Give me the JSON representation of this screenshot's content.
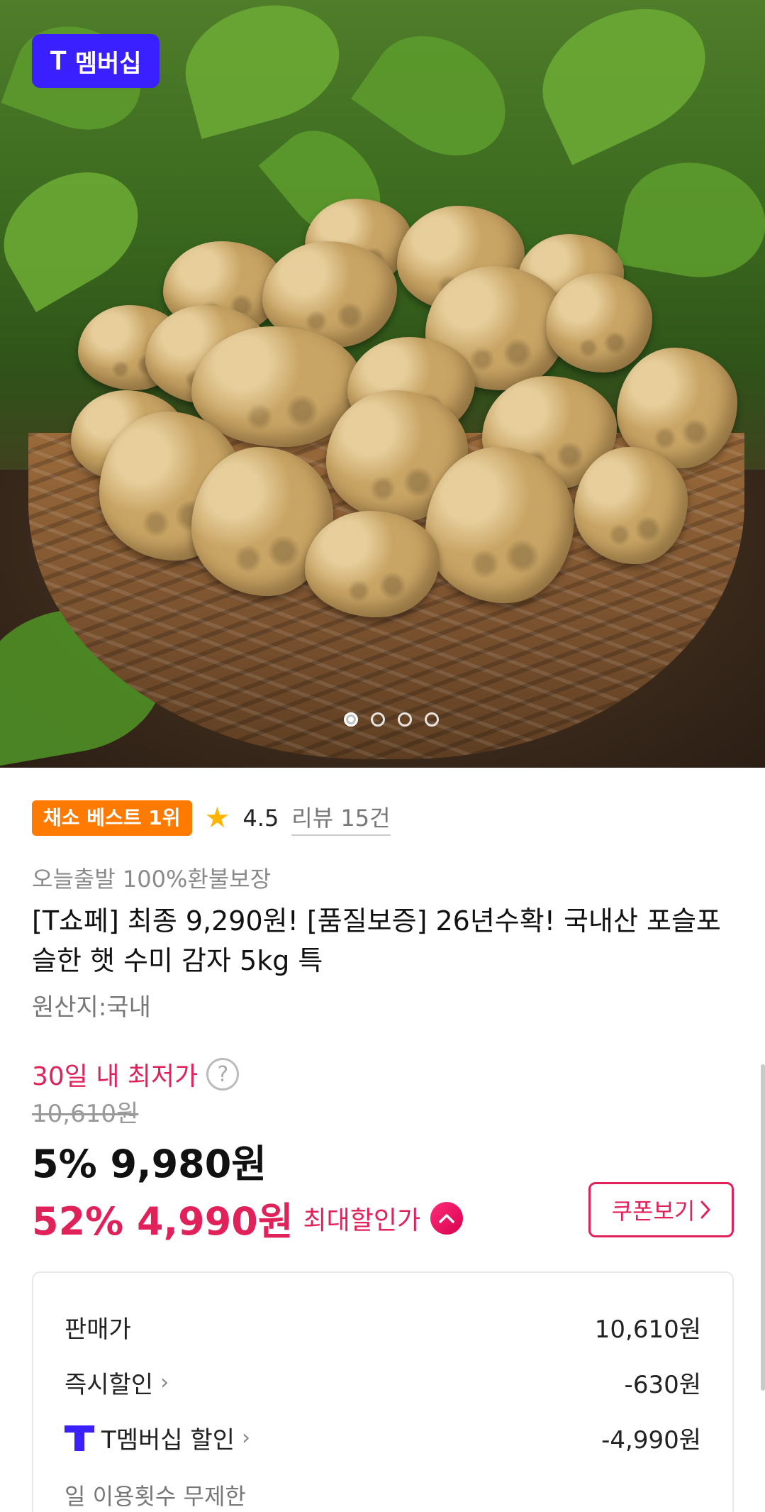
{
  "hero": {
    "brand_badge": "멤버십",
    "brand_mark": "T",
    "carousel": {
      "count": 4,
      "active_index": 0
    }
  },
  "product": {
    "best_badge": "채소 베스트 1위",
    "rating": "4.5",
    "reviews": "리뷰 15건",
    "tags": "오늘출발 100%환불보장",
    "title": "[T쇼페] 최종 9,290원! [품질보증] 26년수확! 국내산 포슬포슬한 햇 수미 감자 5kg 특",
    "origin": "원산지:국내"
  },
  "pricing": {
    "lowest_label": "30일 내 최저가",
    "original_price": "10,610원",
    "sale_line": "5% 9,980원",
    "max_discount_line": "52% 4,990원",
    "max_discount_label": "최대할인가",
    "coupon_button": "쿠폰보기"
  },
  "breakdown": {
    "rows": [
      {
        "label": "판매가",
        "value": "10,610원"
      },
      {
        "label": "즉시할인",
        "value": "-630원"
      },
      {
        "label": "T멤버십 할인",
        "value": "-4,990원"
      }
    ],
    "usage_note": "일 이용횟수 무제한"
  },
  "icons": {
    "star": "star-icon",
    "help": "help-icon",
    "caret_up": "chevron-up-icon",
    "chevron_right": "chevron-right-icon",
    "t_logo": "t-membership-icon"
  },
  "colors": {
    "brand_blue": "#3a1fff",
    "accent_red": "#e0215a",
    "best_orange": "#ff7a00",
    "star_yellow": "#ffb400"
  }
}
